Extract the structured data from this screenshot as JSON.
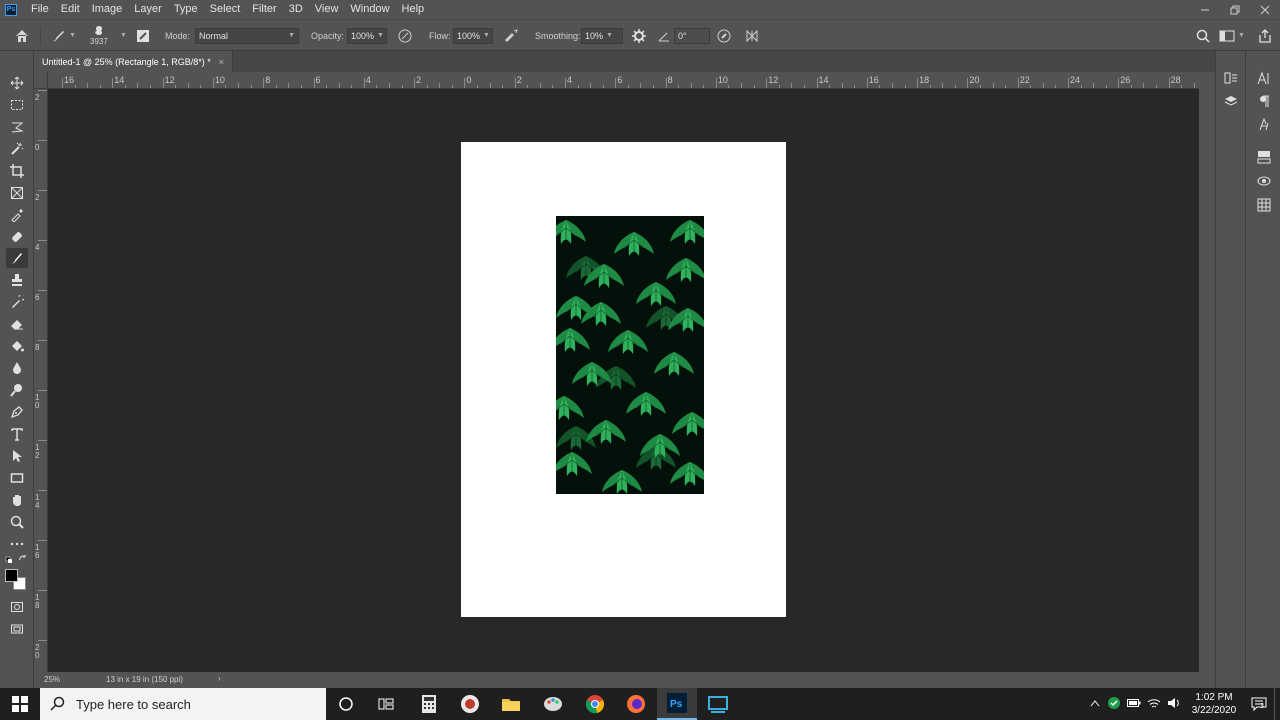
{
  "app": {
    "logo_text": "Ps"
  },
  "menubar": {
    "items": [
      "File",
      "Edit",
      "Image",
      "Layer",
      "Type",
      "Select",
      "Filter",
      "3D",
      "View",
      "Window",
      "Help"
    ]
  },
  "options": {
    "brush_size": "3937",
    "mode_label": "Mode:",
    "mode_value": "Normal",
    "opacity_label": "Opacity:",
    "opacity_value": "100%",
    "flow_label": "Flow:",
    "flow_value": "100%",
    "smoothing_label": "Smoothing:",
    "smoothing_value": "10%",
    "angle_value": "0°"
  },
  "document": {
    "tab_title": "Untitled-1 @ 25% (Rectangle 1, RGB/8*) *",
    "close": "×"
  },
  "ruler": {
    "h_labels": [
      "16",
      "14",
      "12",
      "10",
      "8",
      "6",
      "4",
      "2",
      "0",
      "2",
      "4",
      "6",
      "8",
      "10",
      "12",
      "14",
      "16",
      "18",
      "20",
      "22",
      "24",
      "26",
      "28"
    ],
    "v_labels": [
      "2",
      "0",
      "2",
      "4",
      "6",
      "8",
      "1 0",
      "1 2",
      "1 4",
      "1 6",
      "1 8",
      "2 0"
    ]
  },
  "status": {
    "zoom": "25%",
    "doc_info": "13 in x 19 in (150 ppi)",
    "arrow": "›"
  },
  "taskbar": {
    "search_placeholder": "Type here to search",
    "time": "1:02 PM",
    "date": "3/22/2020",
    "notifications_count": "3"
  },
  "colors": {
    "accent": "#76b9ed",
    "canvas_bg": "#282826",
    "ui_bg": "#535353"
  }
}
